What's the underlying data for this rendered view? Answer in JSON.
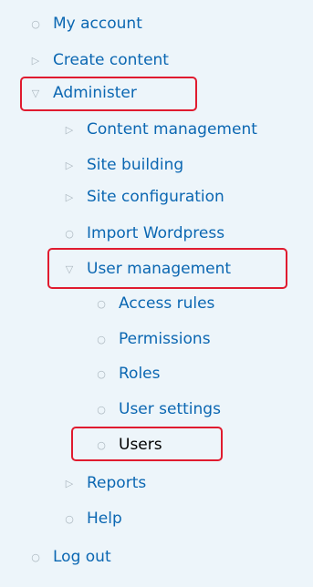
{
  "menu": {
    "items": [
      {
        "label": "My account",
        "icon": "circle-bullet-icon",
        "symbol": "○"
      },
      {
        "label": "Create content",
        "icon": "triangle-right-icon",
        "symbol": "▷"
      },
      {
        "label": "Administer",
        "icon": "triangle-down-icon",
        "symbol": "▽"
      },
      {
        "label": "Content management",
        "icon": "triangle-right-icon",
        "symbol": "▷"
      },
      {
        "label": "Site building",
        "icon": "triangle-right-icon",
        "symbol": "▷"
      },
      {
        "label": "Site configuration",
        "icon": "triangle-right-icon",
        "symbol": "▷"
      },
      {
        "label": "Import Wordpress",
        "icon": "circle-bullet-icon",
        "symbol": "○"
      },
      {
        "label": "User management",
        "icon": "triangle-down-icon",
        "symbol": "▽"
      },
      {
        "label": "Access rules",
        "icon": "circle-bullet-icon",
        "symbol": "○"
      },
      {
        "label": "Permissions",
        "icon": "circle-bullet-icon",
        "symbol": "○"
      },
      {
        "label": "Roles",
        "icon": "circle-bullet-icon",
        "symbol": "○"
      },
      {
        "label": "User settings",
        "icon": "circle-bullet-icon",
        "symbol": "○"
      },
      {
        "label": "Users",
        "icon": "circle-bullet-icon",
        "symbol": "○"
      },
      {
        "label": "Reports",
        "icon": "triangle-right-icon",
        "symbol": "▷"
      },
      {
        "label": "Help",
        "icon": "circle-bullet-icon",
        "symbol": "○"
      },
      {
        "label": "Log out",
        "icon": "circle-bullet-icon",
        "symbol": "○"
      }
    ]
  },
  "colors": {
    "background": "#edf5fa",
    "link": "#0b67b2",
    "active": "#000000",
    "highlight": "#e01b2f"
  }
}
